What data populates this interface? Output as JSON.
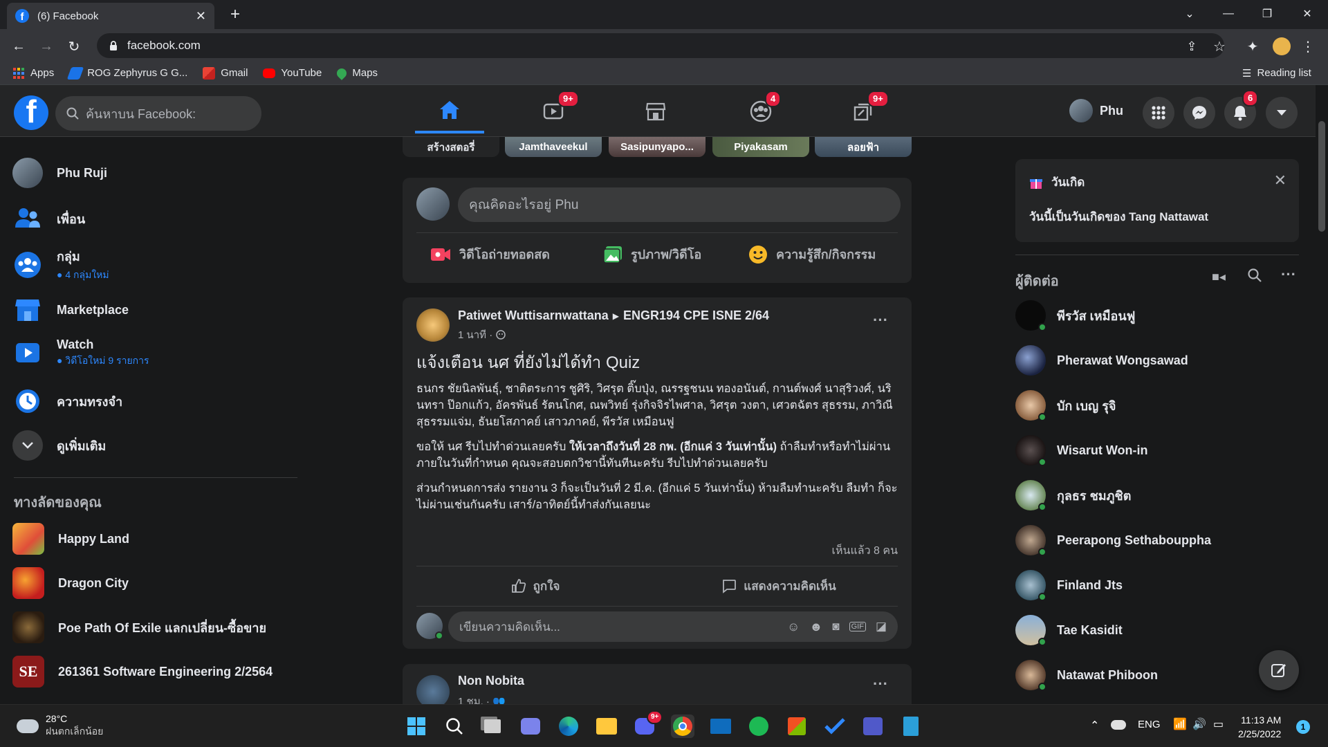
{
  "browser": {
    "tab_title": "(6) Facebook",
    "url": "facebook.com",
    "bookmarks": [
      "Apps",
      "ROG Zephyrus G G...",
      "Gmail",
      "YouTube",
      "Maps"
    ],
    "reading_list": "Reading list"
  },
  "fb_header": {
    "search_placeholder": "ค้นหาบน Facebook:",
    "nav_badges": {
      "watch": "9+",
      "groups": "4",
      "gaming": "9+"
    },
    "profile_name": "Phu",
    "notifications_badge": "6"
  },
  "left_sidebar": {
    "profile_name": "Phu Ruji",
    "items": [
      {
        "label": "เพื่อน",
        "sub": ""
      },
      {
        "label": "กลุ่ม",
        "sub": "4 กลุ่มใหม่"
      },
      {
        "label": "Marketplace",
        "sub": ""
      },
      {
        "label": "Watch",
        "sub": "วิดีโอใหม่ 9 รายการ"
      },
      {
        "label": "ความทรงจำ",
        "sub": ""
      },
      {
        "label": "ดูเพิ่มเติม",
        "sub": ""
      }
    ],
    "shortcuts_title": "ทางลัดของคุณ",
    "shortcuts": [
      "Happy Land",
      "Dragon City",
      "Poe Path Of Exile แลกเปลี่ยน-ซื้อขาย",
      "261361 Software Engineering 2/2564"
    ]
  },
  "stories": [
    "สร้างสตอรี่",
    "Jamthaveekul",
    "Sasipunyapo...",
    "Piyakasam",
    "ลอยฟ้า"
  ],
  "composer": {
    "placeholder": "คุณคิดอะไรอยู่ Phu",
    "live_video": "วิดีโอถ่ายทอดสด",
    "photo_video": "รูปภาพ/วิดีโอ",
    "feeling": "ความรู้สึก/กิจกรรม"
  },
  "post": {
    "author": "Patiwet Wuttisarnwattana",
    "group": "ENGR194 CPE ISNE 2/64",
    "time": "1 นาที ·",
    "title": "แจ้งเตือน นศ ที่ยังไม่ได้ทำ Quiz",
    "body1": "ธนกร ชัยนิลพันธุ์, ชาติตระการ ชูศิริ, วิศรุต ติ๊บปุ่ง, ณรรฐชนน ทองอนันต์, กานต์พงศ์ นาสุริวงศ์, นรินทรา ป๊อกแก้ว, อัครพันธ์ รัตนโกศ, ณพวิทย์ รุ่งกิจจิรไพศาล, วิศรุต วงตา, เศวตฉัตร สุธรรม, ภาวิณี สุธรรมแจ่ม, ธันยโสภาคย์ เสาวภาคย์, พีรวัส เหมือนฟู",
    "body2_a": "ขอให้ นศ รีบไปทำด่วนเลยครับ ",
    "body2_b": "ให้เวลาถึงวันที่ 28 กพ. (อีกแค่ 3 วันเท่านั้น)",
    "body2_c": " ถ้าลืมทำหรือทำไม่ผ่านภายในวันที่กำหนด คุณจะสอบตกวิชานี้ทันทีนะครับ รีบไปทำด่วนเลยครับ",
    "body3": "ส่วนกำหนดการส่ง รายงาน 3 ก็จะเป็นวันที่ 2 มี.ค. (อีกแค่ 5 วันเท่านั้น) ห้ามลืมทำนะครับ ลืมทำ ก็จะไม่ผ่านเช่นกันครับ เสาร์/อาทิตย์นี้ทำส่งกันเลยนะ",
    "seen": "เห็นแล้ว 8 คน",
    "like": "ถูกใจ",
    "comment": "แสดงความคิดเห็น",
    "comment_placeholder": "เขียนความคิดเห็น..."
  },
  "post2": {
    "author": "Non Nobita",
    "time": "1 ชม. ·"
  },
  "right_sidebar": {
    "birthday_title": "วันเกิด",
    "birthday_text": "วันนี้เป็นวันเกิดของ Tang Nattawat",
    "contacts_title": "ผู้ติดต่อ",
    "contacts": [
      "พีรวัส เหมือนฟู",
      "Pherawat Wongsawad",
      "บัก เบญ รุจิ",
      "Wisarut Won-in",
      "กุลธร ชมภูชิต",
      "Peerapong Sethabouppha",
      "Finland Jts",
      "Tae Kasidit",
      "Natawat Phiboon"
    ]
  },
  "taskbar": {
    "temp": "28°C",
    "weather": "ฝนตกเล็กน้อย",
    "lang": "ENG",
    "time": "11:13 AM",
    "date": "2/25/2022",
    "discord_badge": "9+",
    "notif_count": "1"
  },
  "colors": {
    "accent": "#2d88ff",
    "badge": "#e41e3f",
    "online": "#31a24c",
    "fb_blue": "#1877f2"
  }
}
